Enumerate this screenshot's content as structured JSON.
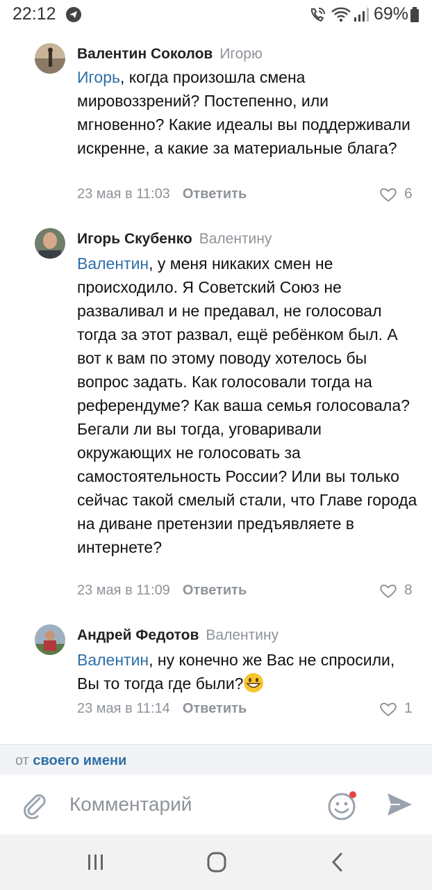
{
  "status_bar": {
    "time": "22:12",
    "battery": "69%"
  },
  "comments": [
    {
      "author": "Валентин Соколов",
      "reply_to": "Игорю",
      "mention": "Игорь",
      "text": ", когда произошла смена мировоззрений? Постепенно, или мгновенно? Какие идеалы вы поддерживали искренне, а какие за материальные блага?",
      "date": "23 мая в 11:03",
      "reply_label": "Ответить",
      "likes": "6"
    },
    {
      "author": "Игорь Скубенко",
      "reply_to": "Валентину",
      "mention": "Валентин",
      "text": ", у меня никаких смен не происходило. Я Советский Союз не разваливал и не предавал, не голосовал тогда за этот развал, ещё ребёнком был. А вот к вам по этому поводу хотелось бы вопрос задать. Как голосовали тогда на референдуме? Как ваша семья голосовала? Бегали ли вы тогда, уговаривали окружающих не голосовать за самостоятельность России? Или вы только сейчас такой смелый стали, что Главе города на диване претензии предъявляете в интернете?",
      "date": "23 мая в 11:09",
      "reply_label": "Ответить",
      "likes": "8"
    },
    {
      "author": "Андрей Федотов",
      "reply_to": "Валентину",
      "mention": "Валентин",
      "text": ", ну конечно же Вас не спросили, Вы то тогда где были?",
      "date": "23 мая в 11:14",
      "reply_label": "Ответить",
      "likes": "1"
    }
  ],
  "composer": {
    "author_prefix": "от",
    "author_name": "своего имени",
    "placeholder": "Комментарий"
  },
  "icons": {
    "status": [
      "telegram-icon",
      "call-wifi-icon",
      "wifi-icon",
      "signal-icon",
      "battery-icon"
    ],
    "composer": [
      "paperclip-icon",
      "emoji-icon",
      "send-icon"
    ],
    "navbar": [
      "recent-apps-icon",
      "home-icon",
      "back-icon"
    ]
  },
  "colors": {
    "link": "#2d6fa8",
    "muted": "#8e9399",
    "notification_dot": "#e64646"
  }
}
